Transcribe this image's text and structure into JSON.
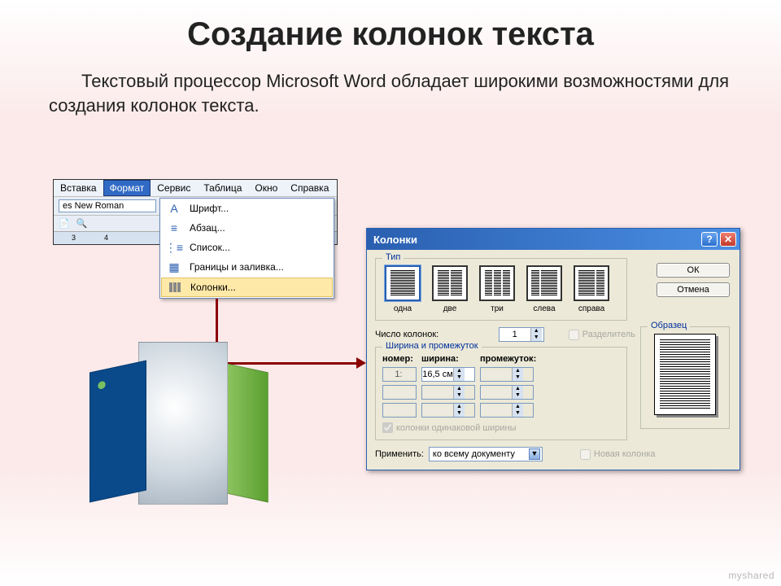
{
  "title": "Создание колонок текста",
  "subtitle": "Текстовый процессор Microsoft Word обладает широкими возможностями для создания колонок текста.",
  "watermark": "myshared",
  "menu": {
    "items": [
      "Вставка",
      "Формат",
      "Сервис",
      "Таблица",
      "Окно",
      "Справка"
    ],
    "font_preview": "es New Roman",
    "ruler_marks": [
      "3",
      "4"
    ],
    "dropdown": {
      "font": "Шрифт...",
      "paragraph": "Абзац...",
      "list": "Список...",
      "borders": "Границы и заливка...",
      "columns": "Колонки..."
    }
  },
  "dialog": {
    "title": "Колонки",
    "group_type": "Тип",
    "type_options": {
      "one": "одна",
      "two": "две",
      "three": "три",
      "left": "слева",
      "right": "справа"
    },
    "ok": "ОК",
    "cancel": "Отмена",
    "count_label": "Число колонок:",
    "count_value": "1",
    "separator": "Разделитель",
    "group_width": "Ширина и промежуток",
    "col_headers": {
      "num": "номер:",
      "width": "ширина:",
      "gap": "промежуток:"
    },
    "row1_num": "1:",
    "row1_width": "16,5 см",
    "equal_width": "колонки одинаковой ширины",
    "preview_label": "Образец",
    "apply_label": "Применить:",
    "apply_value": "ко всему документу",
    "new_column": "Новая колонка"
  }
}
